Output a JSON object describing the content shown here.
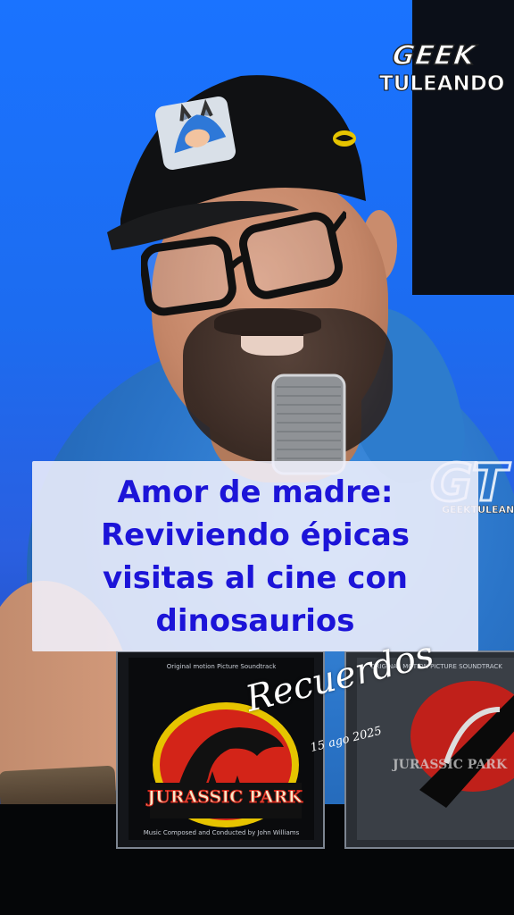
{
  "logo": {
    "line1": "GEEK",
    "line2": "TULEANDO"
  },
  "watermark": {
    "monogram": "GT",
    "text": "GEEKTULEANDO"
  },
  "caption": {
    "lines": [
      "Amor de madre:",
      "Reviviendo épicas",
      "visitas al cine con",
      "dinosaurios"
    ]
  },
  "overlay": {
    "title": "Recuerdos",
    "date": "15 ago 2025"
  },
  "cd_left": {
    "top_text": "Original motion Picture Soundtrack",
    "logo_text": "JURASSIC PARK",
    "bottom_text": "Music Composed and Conducted by John Williams"
  },
  "cd_right": {
    "top_text": "ORIGINAL MOTION PICTURE SOUNDTRACK",
    "logo_text": "JURASSIC PARK"
  },
  "colors": {
    "caption_text": "#1c14d8",
    "background": "#1a73ff",
    "shirt": "#2a74c8"
  }
}
